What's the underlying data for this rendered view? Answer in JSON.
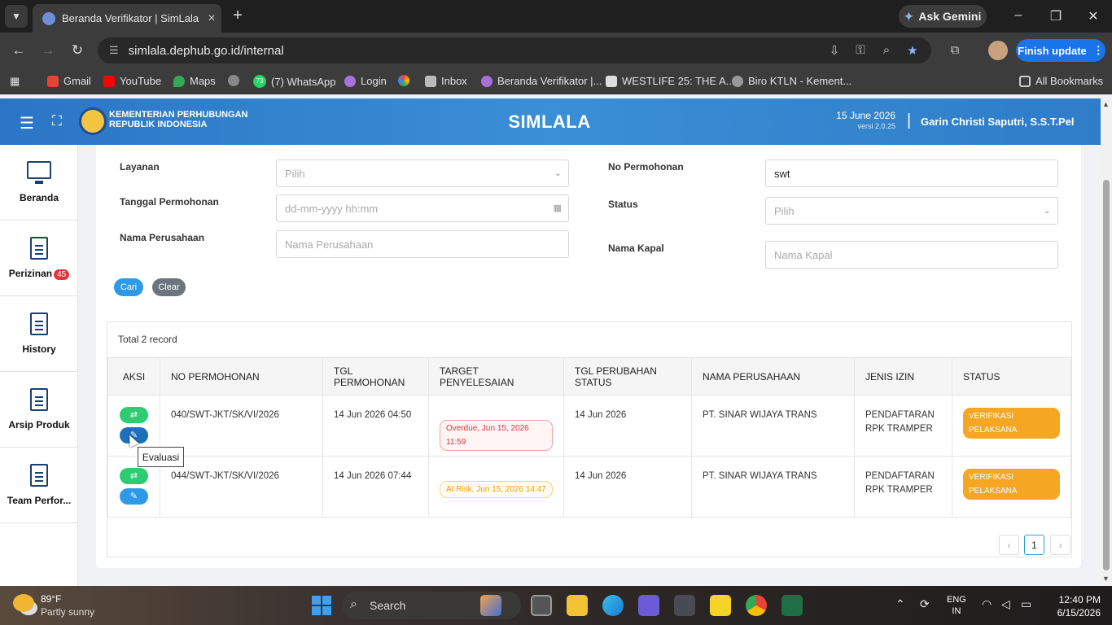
{
  "browser": {
    "tab_title": "Beranda Verifikator | SimLala",
    "ask_gemini": "Ask Gemini",
    "url": "simlala.dephub.go.id/internal",
    "finish_update": "Finish update",
    "bookmarks": [
      "Gmail",
      "YouTube",
      "Maps",
      "",
      "(7) WhatsApp",
      "Login",
      "",
      "Inbox",
      "Beranda Verifikator |...",
      "WESTLIFE 25: THE A...",
      "Biro KTLN - Kement..."
    ],
    "whatsapp_count": "73",
    "all_bookmarks": "All Bookmarks"
  },
  "header": {
    "ministry_line1": "KEMENTERIAN PERHUBUNGAN",
    "ministry_line2": "REPUBLIK INDONESIA",
    "app_name": "SIMLALA",
    "date": "15 June 2026",
    "version": "versi 2.0.25",
    "separator": "|",
    "user": "Garin Christi Saputri, S.S.T.Pel"
  },
  "sidebar": {
    "items": [
      {
        "label": "Beranda"
      },
      {
        "label": "Perizinan",
        "badge": "45"
      },
      {
        "label": "History"
      },
      {
        "label": "Arsip Produk"
      },
      {
        "label": "Team Perfor..."
      }
    ]
  },
  "filters": {
    "layanan_label": "Layanan",
    "layanan_value": "Pilih",
    "tanggal_label": "Tanggal Permohonan",
    "tanggal_placeholder": "dd-mm-yyyy hh:mm",
    "perusahaan_label": "Nama Perusahaan",
    "perusahaan_placeholder": "Nama Perusahaan",
    "no_label": "No Permohonan",
    "no_value": "swt",
    "status_label": "Status",
    "status_value": "Pilih",
    "kapal_label": "Nama Kapal",
    "kapal_placeholder": "Nama Kapal",
    "cari": "Cari",
    "clear": "Clear"
  },
  "table": {
    "total": "Total 2 record",
    "headers": [
      "AKSI",
      "NO PERMOHONAN",
      "TGL PERMOHONAN",
      "TARGET PENYELESAIAN",
      "TGL PERUBAHAN STATUS",
      "NAMA PERUSAHAAN",
      "JENIS IZIN",
      "STATUS"
    ],
    "rows": [
      {
        "no": "040/SWT-JKT/SK/VI/2026",
        "tgl": "14 Jun 2026 04:50",
        "target": "Overdue, Jun 15, 2026 11:59",
        "perubahan": "14 Jun 2026",
        "perusahaan": "PT. SINAR WIJAYA TRANS",
        "jenis": "PENDAFTARAN RPK TRAMPER",
        "status": "VERIFIKASI PELAKSANA"
      },
      {
        "no": "044/SWT-JKT/SK/VI/2026",
        "tgl": "14 Jun 2026 07:44",
        "target": "At Risk, Jun 15, 2026 14:47",
        "perubahan": "14 Jun 2026",
        "perusahaan": "PT. SINAR WIJAYA TRANS",
        "jenis": "PENDAFTARAN RPK TRAMPER",
        "status": "VERIFIKASI PELAKSANA"
      }
    ],
    "tooltip": "Evaluasi",
    "pager": {
      "prev": "‹",
      "current": "1",
      "next": "›"
    }
  },
  "taskbar": {
    "temp": "89°F",
    "weather": "Partly sunny",
    "search": "Search",
    "lang1": "ENG",
    "lang2": "IN",
    "time": "12:40 PM",
    "date": "6/15/2026"
  },
  "colors": {
    "accent": "#2c9ae8",
    "header": "#2b75c5",
    "status": "#f5a623",
    "overdue": "#e0353c",
    "at_risk": "#e6a100"
  }
}
